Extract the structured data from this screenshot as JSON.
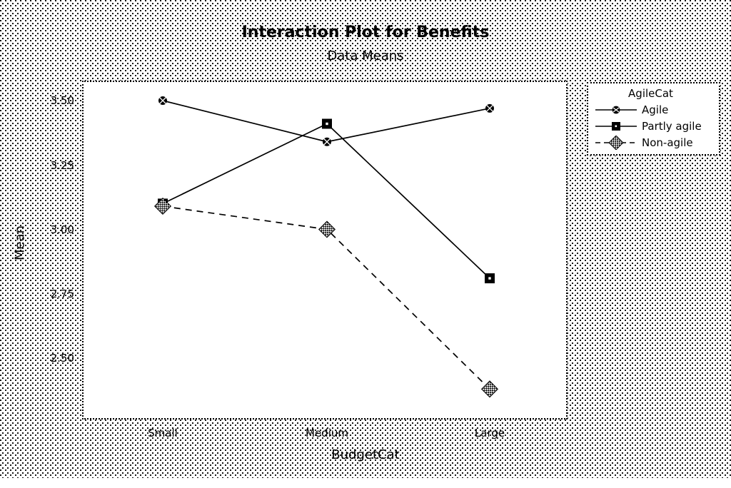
{
  "chart_data": {
    "type": "line",
    "title": "Interaction Plot for Benefits",
    "subtitle": "Data Means",
    "xlabel": "BudgetCat",
    "ylabel": "Mean",
    "categories": [
      "Small",
      "Medium",
      "Large"
    ],
    "ylim": [
      2.36,
      3.57
    ],
    "yticks": [
      "3.50",
      "3.25",
      "3.00",
      "2.75",
      "2.50"
    ],
    "ytick_values": [
      3.5,
      3.25,
      3.0,
      2.75,
      2.5
    ],
    "grid": false,
    "legend_position": "right",
    "legend_title": "AgileCat",
    "series": [
      {
        "name": "Agile",
        "values": [
          3.5,
          3.34,
          3.47
        ],
        "marker": "circle",
        "linestyle": "solid",
        "color": "#000000"
      },
      {
        "name": "Partly agile",
        "values": [
          3.1,
          3.41,
          2.81
        ],
        "marker": "square",
        "linestyle": "solid",
        "color": "#000000"
      },
      {
        "name": "Non-agile",
        "values": [
          3.09,
          3.0,
          2.38
        ],
        "marker": "diamond",
        "linestyle": "dashed",
        "color": "#000000"
      }
    ]
  },
  "legend": {
    "title": "AgileCat",
    "entries": [
      {
        "label": "Agile",
        "marker": "circle-marker-icon",
        "linestyle": "solid"
      },
      {
        "label": "Partly agile",
        "marker": "square-marker-icon",
        "linestyle": "solid"
      },
      {
        "label": "Non-agile",
        "marker": "diamond-marker-icon",
        "linestyle": "dashed"
      }
    ]
  },
  "axes": {
    "y_ticks": [
      "3.50",
      "3.25",
      "3.00",
      "2.75",
      "2.50"
    ],
    "x_ticks": [
      "Small",
      "Medium",
      "Large"
    ],
    "x_title": "BudgetCat",
    "y_title": "Mean"
  },
  "colors": {
    "foreground": "#000000",
    "plot_background": "#ffffff",
    "page_background": "#ffffff"
  }
}
